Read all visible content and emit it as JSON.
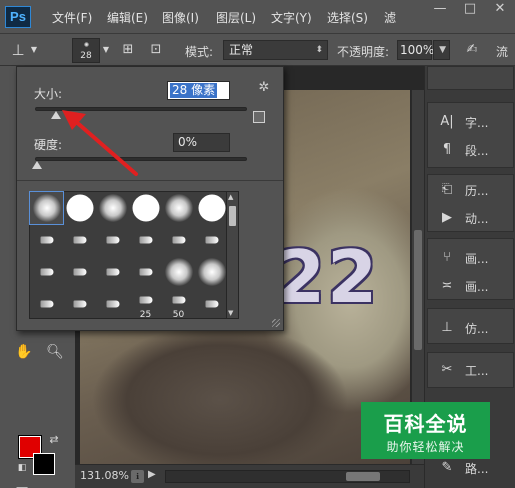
{
  "app": {
    "logo": "Ps"
  },
  "menubar": {
    "items": [
      "文件(F)",
      "编辑(E)",
      "图像(I)",
      "图层(L)",
      "文字(Y)",
      "选择(S)",
      "滤"
    ],
    "window_controls": {
      "minimize": "—",
      "maximize": "□",
      "close": "✕"
    }
  },
  "options_bar": {
    "tool_icon": "stamp-icon",
    "brush_size": "28",
    "mode_label": "模式:",
    "mode_value": "正常",
    "opacity_label": "不透明度:",
    "opacity_value": "100%",
    "flow_label": "流"
  },
  "brush_popup": {
    "size_label": "大小:",
    "size_value": "28 像素",
    "size_fraction": 0.1,
    "hardness_label": "硬度:",
    "hardness_value": "0%",
    "hardness_fraction": 0,
    "presets": [
      {
        "kind": "soft-round",
        "selected": true
      },
      {
        "kind": "hard-round"
      },
      {
        "kind": "soft-round"
      },
      {
        "kind": "hard-round"
      },
      {
        "kind": "soft-round"
      },
      {
        "kind": "hard-round"
      },
      {
        "kind": "tip"
      },
      {
        "kind": "tip"
      },
      {
        "kind": "tip"
      },
      {
        "kind": "tip"
      },
      {
        "kind": "tip"
      },
      {
        "kind": "tip"
      },
      {
        "kind": "tip"
      },
      {
        "kind": "tip"
      },
      {
        "kind": "tip"
      },
      {
        "kind": "tip"
      },
      {
        "kind": "soft-round"
      },
      {
        "kind": "soft-round"
      },
      {
        "kind": "tip"
      },
      {
        "kind": "tip"
      },
      {
        "kind": "tip"
      },
      {
        "kind": "tip",
        "label": "25"
      },
      {
        "kind": "tip",
        "label": "50"
      },
      {
        "kind": "tip"
      }
    ]
  },
  "canvas": {
    "photo_text": "22"
  },
  "status_bar": {
    "zoom": "131.08%"
  },
  "right_panel": {
    "items": [
      {
        "icon": "character-icon",
        "label": "字..."
      },
      {
        "icon": "paragraph-icon",
        "label": "段..."
      },
      {
        "icon": "history-icon",
        "label": "历..."
      },
      {
        "icon": "actions-icon",
        "label": "动..."
      },
      {
        "icon": "brush-panel-icon",
        "label": "画..."
      },
      {
        "icon": "brush-presets-icon",
        "label": "画..."
      },
      {
        "icon": "clone-source-icon",
        "label": "仿..."
      },
      {
        "icon": "tool-presets-icon",
        "label": "工..."
      },
      {
        "icon": "paths-icon",
        "label": "路..."
      }
    ]
  },
  "watermark": {
    "title": "百科全说",
    "subtitle": "助你轻松解决"
  },
  "colors": {
    "foreground": "#e00000",
    "background": "#000000",
    "annotation": "#e02020",
    "watermark": "#1a9e4b"
  }
}
